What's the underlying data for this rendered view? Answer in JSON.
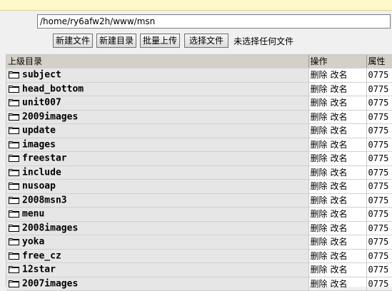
{
  "path": {
    "value": "/home/ry6afw2h/www/msn"
  },
  "toolbar": {
    "new_file": "新建文件",
    "new_dir": "新建目录",
    "batch_upload": "批量上传",
    "choose_file": "选择文件",
    "no_file": "未选择任何文件"
  },
  "table": {
    "headers": {
      "name": "上级目录",
      "actions": "操作",
      "attr": "属性"
    },
    "delete_label": "删除",
    "rename_label": "改名",
    "rows": [
      {
        "name": "subject",
        "attr": "0775"
      },
      {
        "name": "head_bottom",
        "attr": "0775"
      },
      {
        "name": "unit007",
        "attr": "0775"
      },
      {
        "name": "2009images",
        "attr": "0775"
      },
      {
        "name": "update",
        "attr": "0775"
      },
      {
        "name": "images",
        "attr": "0775"
      },
      {
        "name": "freestar",
        "attr": "0775"
      },
      {
        "name": "include",
        "attr": "0775"
      },
      {
        "name": "nusoap",
        "attr": "0775"
      },
      {
        "name": "2008msn3",
        "attr": "0775"
      },
      {
        "name": "menu",
        "attr": "0775"
      },
      {
        "name": "2008images",
        "attr": "0775"
      },
      {
        "name": "yoka",
        "attr": "0775"
      },
      {
        "name": "free_cz",
        "attr": "0775"
      },
      {
        "name": "12star",
        "attr": "0775"
      },
      {
        "name": "2007images",
        "attr": "0775"
      }
    ]
  },
  "icons": {
    "folder": "folder-icon"
  }
}
